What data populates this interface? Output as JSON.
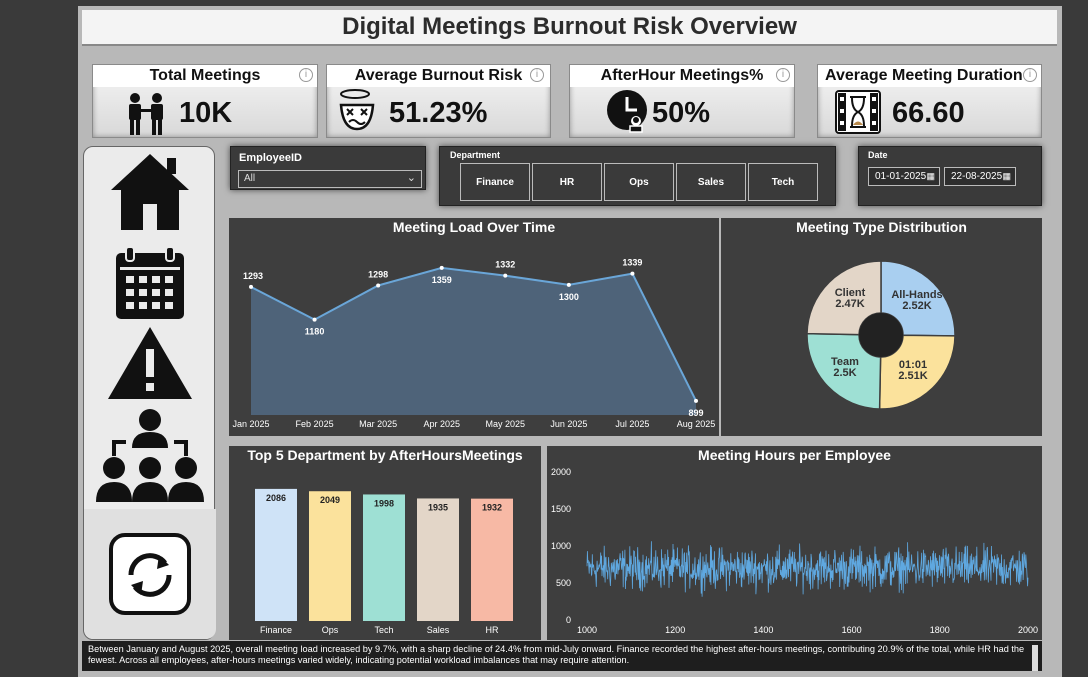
{
  "title": "Digital Meetings Burnout Risk Overview",
  "kpis": [
    {
      "label": "Total Meetings",
      "value": "10K",
      "icon": "people-meeting-icon"
    },
    {
      "label": "Average Burnout Risk",
      "value": "51.23%",
      "icon": "dizzy-face-icon"
    },
    {
      "label": "AfterHour Meetings%",
      "value": "50%",
      "icon": "clock-person-icon"
    },
    {
      "label": "Average Meeting Duration",
      "value": "66.60",
      "icon": "hourglass-film-icon"
    }
  ],
  "nav": [
    "home-icon",
    "calendar-icon",
    "warning-icon",
    "org-chart-icon",
    "refresh-icon"
  ],
  "filters": {
    "employee_label": "EmployeeID",
    "employee_value": "All",
    "department_label": "Department",
    "departments": [
      "Finance",
      "HR",
      "Ops",
      "Sales",
      "Tech"
    ],
    "date_label": "Date",
    "date_start": "01-01-2025",
    "date_end": "22-08-2025"
  },
  "chart_data": [
    {
      "type": "area",
      "title": "Meeting Load Over Time",
      "categories": [
        "Jan 2025",
        "Feb 2025",
        "Mar 2025",
        "Apr 2025",
        "May 2025",
        "Jun 2025",
        "Jul 2025",
        "Aug 2025"
      ],
      "values": [
        1293,
        1180,
        1298,
        1359,
        1332,
        1300,
        1339,
        899
      ],
      "color": "#6aa6d8"
    },
    {
      "type": "pie",
      "title": "Meeting Type Distribution",
      "slices": [
        {
          "label": "All-Hands",
          "display": "2.52K",
          "value": 2520,
          "color": "#a9cff0"
        },
        {
          "label": "01:01",
          "display": "2.51K",
          "value": 2510,
          "color": "#fbe29c"
        },
        {
          "label": "Team",
          "display": "2.5K",
          "value": 2500,
          "color": "#9ee0d4"
        },
        {
          "label": "Client",
          "display": "2.47K",
          "value": 2470,
          "color": "#e3d6c8"
        }
      ]
    },
    {
      "type": "bar",
      "title": "Top 5 Department by AfterHoursMeetings",
      "categories": [
        "Finance",
        "Ops",
        "Tech",
        "Sales",
        "HR"
      ],
      "values": [
        2086,
        2049,
        1998,
        1935,
        1932
      ],
      "colors": [
        "#cfe3f7",
        "#fbe29c",
        "#9ee0d4",
        "#e3d6c8",
        "#f7b9a5"
      ]
    },
    {
      "type": "line",
      "title": "Meeting Hours per Employee",
      "x_ticks": [
        "1000",
        "1200",
        "1400",
        "1600",
        "1800",
        "2000"
      ],
      "y_ticks": [
        "0",
        "500",
        "1000",
        "1500",
        "2000"
      ],
      "xlim": [
        1000,
        2000
      ],
      "ylim": [
        0,
        2000
      ],
      "series_mean": 700,
      "series_spread": 170,
      "color": "#5fa8e0"
    }
  ],
  "footer": "Between January and August 2025, overall meeting load increased by 9.7%, with a sharp decline of 24.4% from mid-July onward. Finance recorded the highest after-hours meetings, contributing 20.9% of the total, while HR had the fewest. Across all employees, after-hours meetings varied widely, indicating potential workload imbalances that may require attention."
}
